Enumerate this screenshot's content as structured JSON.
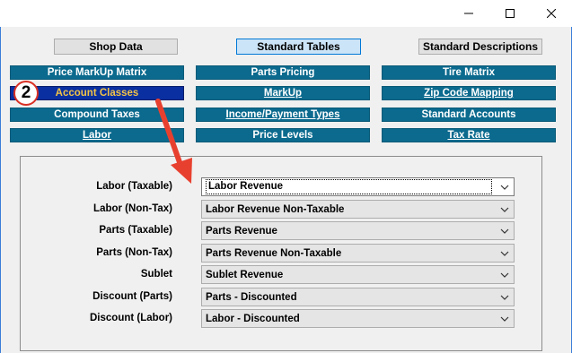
{
  "window": {
    "minimize_icon": "minimize-icon",
    "maximize_icon": "maximize-icon",
    "close_icon": "close-icon"
  },
  "tabs": [
    {
      "label": "Shop Data",
      "active": false
    },
    {
      "label": "Standard Tables",
      "active": true
    },
    {
      "label": "Standard Descriptions",
      "active": false
    }
  ],
  "nav": {
    "col1": [
      {
        "label": "Price MarkUp Matrix"
      },
      {
        "label": "Account Classes",
        "selected": true
      },
      {
        "label": "Compound Taxes"
      },
      {
        "label": "Labor"
      }
    ],
    "col2": [
      {
        "label": "Parts Pricing"
      },
      {
        "label": "MarkUp"
      },
      {
        "label": "Income/Payment Types"
      },
      {
        "label": "Price Levels"
      }
    ],
    "col3": [
      {
        "label": "Tire Matrix"
      },
      {
        "label": "Zip Code Mapping"
      },
      {
        "label": "Standard Accounts"
      },
      {
        "label": "Tax Rate"
      }
    ]
  },
  "annotation": {
    "step_number": "2",
    "accent_color": "#d93025"
  },
  "account_classes": [
    {
      "label": "Labor (Taxable)",
      "value": "Labor Revenue"
    },
    {
      "label": "Labor (Non-Tax)",
      "value": "Labor Revenue Non-Taxable"
    },
    {
      "label": "Parts (Taxable)",
      "value": "Parts Revenue"
    },
    {
      "label": "Parts (Non-Tax)",
      "value": "Parts Revenue Non-Taxable"
    },
    {
      "label": "Sublet",
      "value": "Sublet Revenue"
    },
    {
      "label": "Discount (Parts)",
      "value": "Parts - Discounted"
    },
    {
      "label": "Discount (Labor)",
      "value": "Labor - Discounted"
    }
  ]
}
